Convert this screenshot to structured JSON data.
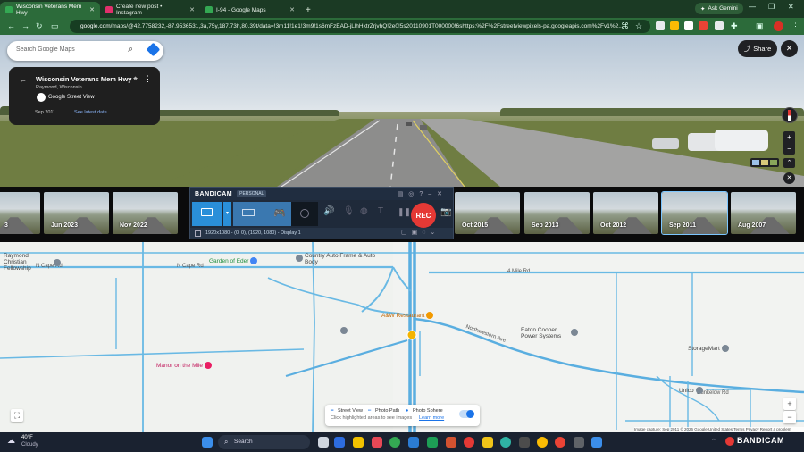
{
  "browser": {
    "tabs": [
      {
        "title": "Wisconsin Veterans Mem Hwy",
        "active": true,
        "favicon_color": "#34a853"
      },
      {
        "title": "Create new post • Instagram",
        "active": false,
        "favicon_color": "#e1306c"
      },
      {
        "title": "I-94 - Google Maps",
        "active": false,
        "favicon_color": "#34a853"
      }
    ],
    "new_tab": "+",
    "ask_gemini": "Ask Gemini",
    "url_host": "google.com",
    "url_path": "/maps/@42.7758232,-87.9536531,3a,75y,187.73h,80.39t/data=!3m11!1e1!3m9!1s6mFzEAD-jLlhHktrZrjvhQ!2e0!5s20110901T000000!6shttps:%2F%2Fstreetviewpixels-pa.googleapis.com%2Fv1%2..."
  },
  "streetview": {
    "search_placeholder": "Search Google Maps",
    "place_title": "Wisconsin Veterans Mem Hwy",
    "place_subtitle": "Raymond, Wisconsin",
    "source": "Google Street View",
    "capture_date": "Sep 2011",
    "see_latest": "See latest date",
    "share_label": "Share"
  },
  "timeline": [
    {
      "label": "3"
    },
    {
      "label": "Jun 2023"
    },
    {
      "label": "Nov 2022"
    },
    {
      "label": ""
    },
    {
      "label": "Oct 2015"
    },
    {
      "label": "Sep 2013"
    },
    {
      "label": "Oct 2012"
    },
    {
      "label": "Sep 2011",
      "selected": true
    },
    {
      "label": "Aug 2007"
    }
  ],
  "bandicam": {
    "brand": "BANDICAM",
    "edition": "PERSONAL",
    "rec_label": "REC",
    "resolution": "1920x1080 - (0, 0), (1920, 1080) - Display 1"
  },
  "map": {
    "labels": {
      "church": "Raymond Christian Fellowship",
      "garden": "Garden of Eder",
      "auto": "Country Auto Frame & Auto Body",
      "aw": "A&W Restaurant",
      "eaton": "Eaton Cooper Power Systems",
      "storage": "StorageMart",
      "unico": "Unico",
      "manor": "Manor on the Mile",
      "road_n_cape_1": "N Cape Rd",
      "road_n_cape_2": "N Cape Rd",
      "road_4_mile": "4 Mile Rd",
      "road_northwestern": "Northwestern Ave",
      "road_dunkelow": "Dunkelow Rd"
    },
    "legend": {
      "street_view": "Street View",
      "photo_path": "Photo Path",
      "photo_sphere": "Photo Sphere",
      "hint": "Click highlighted areas to see images",
      "learn_more": "Learn more"
    },
    "attribution": "Image capture: Sep 2011   © 2026 Google   United States   Terms   Privacy   Report a problem"
  },
  "taskbar": {
    "weather_temp": "40°F",
    "weather_desc": "Cloudy",
    "search_label": "Search",
    "tray_brand": "BANDICAM"
  }
}
